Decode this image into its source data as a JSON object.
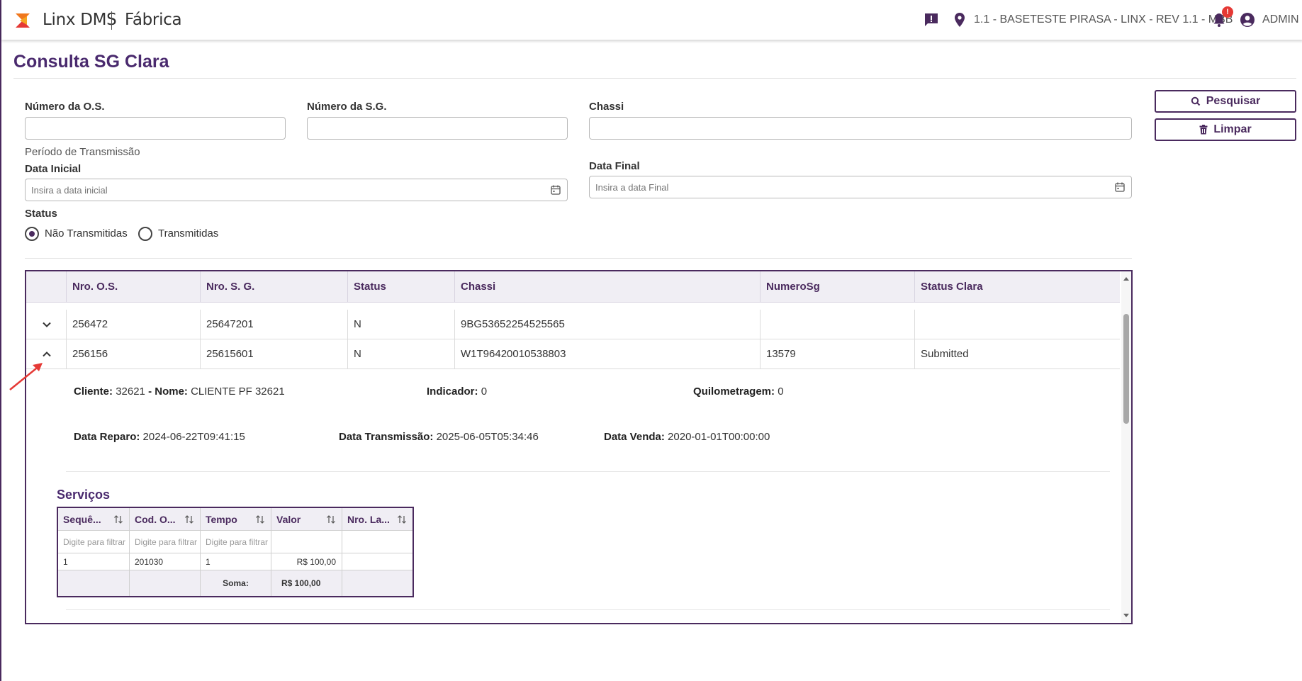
{
  "header": {
    "brand": "Linx DMS",
    "module": "Fábrica",
    "location": "1.1 - BASETESTE PIRASA - LINX - REV 1.1 - MBB",
    "notification_count": "!",
    "user": "ADMIN",
    "icons": [
      "feedback-icon",
      "location-pin-icon",
      "bell-icon",
      "account-circle-icon"
    ]
  },
  "page": {
    "title": "Consulta SG Clara"
  },
  "filters": {
    "os_label": "Número da O.S.",
    "os_value": "",
    "sg_label": "Número da S.G.",
    "sg_value": "",
    "chassi_label": "Chassi",
    "chassi_value": "",
    "periodo_label": "Período de Transmissão",
    "data_inicial_label": "Data Inicial",
    "data_inicial_placeholder": "Insira a data inicial",
    "data_final_label": "Data Final",
    "data_final_placeholder": "Insira a data Final",
    "status_label": "Status",
    "status_options": [
      "Não Transmitidas",
      "Transmitidas"
    ],
    "status_selected": "Não Transmitidas"
  },
  "actions": {
    "pesquisar": "Pesquisar",
    "limpar": "Limpar"
  },
  "grid": {
    "columns": [
      "Nro. O.S.",
      "Nro. S. G.",
      "Status",
      "Chassi",
      "NumeroSg",
      "Status Clara"
    ],
    "rows": [
      {
        "os": "256472",
        "sg": "25647201",
        "status": "N",
        "chassi": "9BG53652254525565",
        "numero_sg": "",
        "status_clara": "",
        "expanded": false
      },
      {
        "os": "256156",
        "sg": "25615601",
        "status": "N",
        "chassi": "W1T96420010538803",
        "numero_sg": "13579",
        "status_clara": "Submitted",
        "expanded": true
      }
    ],
    "detail": {
      "cliente_label": "Cliente:",
      "cliente_value": "32621",
      "nome_label": "- Nome:",
      "nome_value": "CLIENTE PF 32621",
      "indicador_label": "Indicador:",
      "indicador_value": "0",
      "quilometragem_label": "Quilometragem:",
      "quilometragem_value": "0",
      "data_reparo_label": "Data Reparo:",
      "data_reparo_value": "2024-06-22T09:41:15",
      "data_transmissao_label": "Data Transmissão:",
      "data_transmissao_value": "2025-06-05T05:34:46",
      "data_venda_label": "Data Venda:",
      "data_venda_value": "2020-01-01T00:00:00"
    },
    "servicos": {
      "title": "Serviços",
      "columns": [
        "Sequê...",
        "Cod. O...",
        "Tempo",
        "Valor",
        "Nro. La..."
      ],
      "filter_placeholder": "Digite para filtrar",
      "rows": [
        {
          "sequencia": "1",
          "cod": "201030",
          "tempo": "1",
          "valor": "R$ 100,00",
          "nro": ""
        }
      ],
      "soma_label": "Soma:",
      "soma_value": "R$ 100,00"
    }
  },
  "colors": {
    "primary": "#4a2a5e",
    "accent": "#f0781e",
    "badge": "#e53935"
  }
}
